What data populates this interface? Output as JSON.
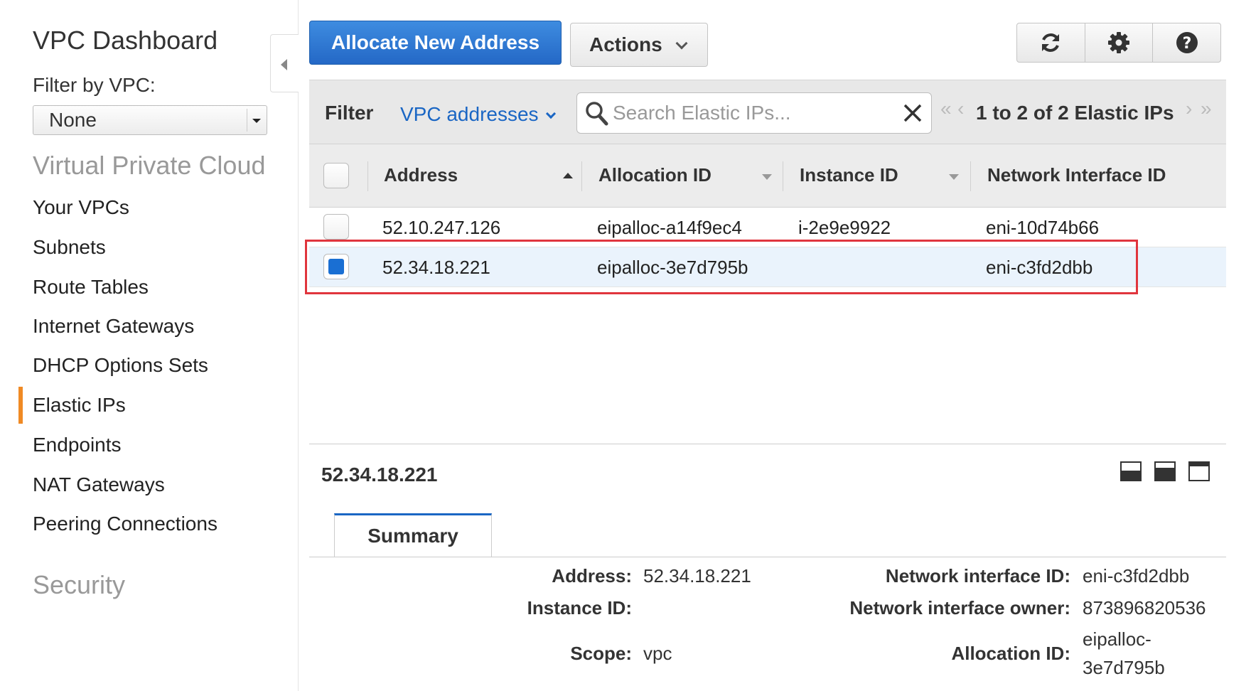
{
  "sidebar": {
    "title": "VPC Dashboard",
    "filter_label": "Filter by VPC:",
    "filter_value": "None",
    "section_vpc": "Virtual Private Cloud",
    "items": [
      {
        "label": "Your VPCs"
      },
      {
        "label": "Subnets"
      },
      {
        "label": "Route Tables"
      },
      {
        "label": "Internet Gateways"
      },
      {
        "label": "DHCP Options Sets"
      },
      {
        "label": "Elastic IPs"
      },
      {
        "label": "Endpoints"
      },
      {
        "label": "NAT Gateways"
      },
      {
        "label": "Peering Connections"
      }
    ],
    "active_item": "Elastic IPs",
    "section_security": "Security"
  },
  "toolbar": {
    "allocate_label": "Allocate New Address",
    "actions_label": "Actions",
    "icons": [
      "refresh-icon",
      "gear-icon",
      "help-icon"
    ]
  },
  "filter": {
    "label": "Filter",
    "scope": "VPC addresses",
    "search_placeholder": "Search Elastic IPs...",
    "pager_text": "1 to 2 of 2 Elastic IPs"
  },
  "table": {
    "columns": [
      "Address",
      "Allocation ID",
      "Instance ID",
      "Network Interface ID"
    ],
    "rows": [
      {
        "address": "52.10.247.126",
        "allocation_id": "eipalloc-a14f9ec4",
        "instance_id": "i-2e9e9922",
        "eni": "eni-10d74b66",
        "selected": false
      },
      {
        "address": "52.34.18.221",
        "allocation_id": "eipalloc-3e7d795b",
        "instance_id": "",
        "eni": "eni-c3fd2dbb",
        "selected": true
      }
    ]
  },
  "detail": {
    "title": "52.34.18.221",
    "tab": "Summary",
    "left": [
      {
        "label": "Address:",
        "value": "52.34.18.221"
      },
      {
        "label": "Instance ID:",
        "value": ""
      },
      {
        "label": "Scope:",
        "value": "vpc"
      }
    ],
    "right": [
      {
        "label": "Network interface ID:",
        "value": "eni-c3fd2dbb"
      },
      {
        "label": "Network interface owner:",
        "value": "873896820536"
      },
      {
        "label": "Allocation ID:",
        "value_line1": "eipalloc-",
        "value_line2": "3e7d795b"
      }
    ]
  },
  "colors": {
    "primary": "#2468c6",
    "link": "#1a66c4",
    "active_nav": "#f08a24",
    "highlight": "#e0353d",
    "selected_row": "#eaf3fc"
  }
}
